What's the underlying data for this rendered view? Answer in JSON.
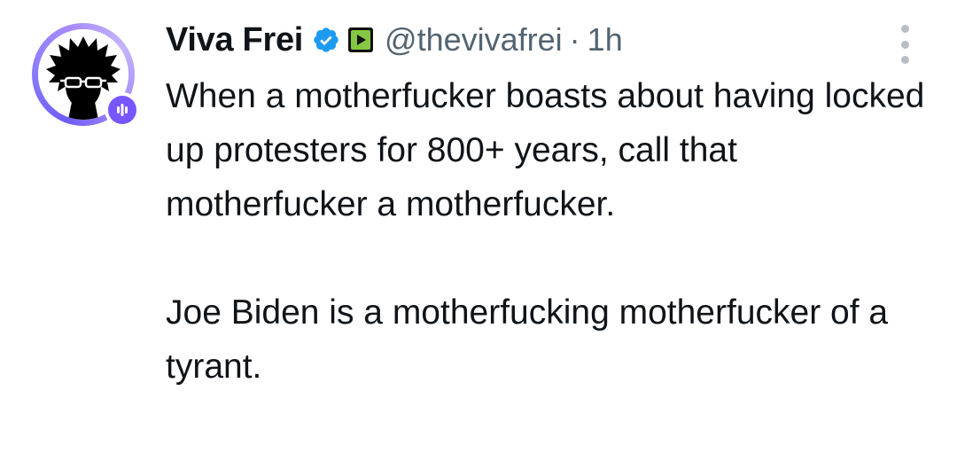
{
  "tweet": {
    "author": {
      "display_name": "Viva Frei",
      "handle": "@thevivafrei",
      "verified_icon": "verified-badge-icon",
      "affiliate_icon": "rumble-affiliate-icon",
      "avatar_icon": "afro-silhouette-avatar",
      "badge_icon": "spaces-live-icon"
    },
    "separator": "·",
    "timestamp": "1h",
    "text_paragraph_1": "When a motherfucker boasts about having locked up protesters for 800+ years, call that motherfucker a motherfucker.",
    "text_paragraph_2": "Joe Biden is a motherfucking motherfucker of a tyrant.",
    "colors": {
      "text": "#0f1419",
      "secondary": "#536471",
      "verified": "#1d9bf0",
      "affiliate": "#85c742",
      "spaces": "#7856ff",
      "ring": "#8b7bff"
    }
  }
}
